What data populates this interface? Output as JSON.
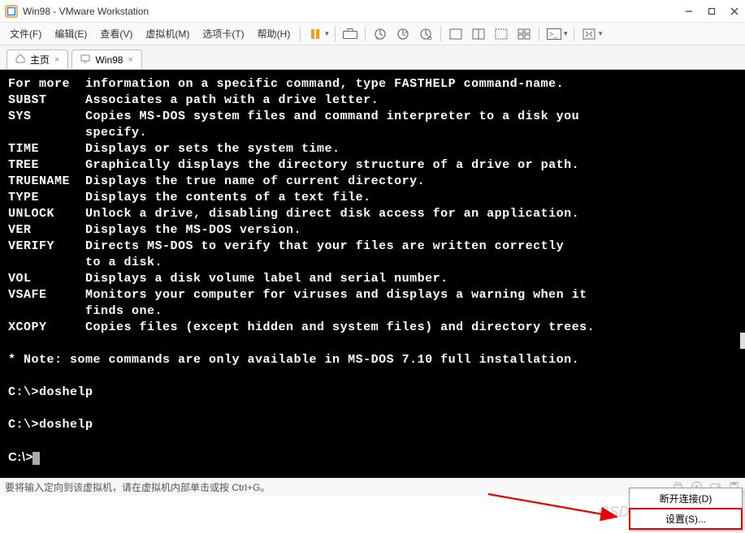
{
  "window": {
    "title": "Win98 - VMware Workstation"
  },
  "menu": {
    "items": [
      "文件(F)",
      "编辑(E)",
      "查看(V)",
      "虚拟机(M)",
      "选项卡(T)",
      "帮助(H)"
    ]
  },
  "tabs": {
    "home": "主页",
    "active": "Win98"
  },
  "console": {
    "lines": [
      "For more  information on a specific command, type FASTHELP command-name.",
      "SUBST     Associates a path with a drive letter.",
      "SYS       Copies MS-DOS system files and command interpreter to a disk you",
      "          specify.",
      "TIME      Displays or sets the system time.",
      "TREE      Graphically displays the directory structure of a drive or path.",
      "TRUENAME  Displays the true name of current directory.",
      "TYPE      Displays the contents of a text file.",
      "UNLOCK    Unlock a drive, disabling direct disk access for an application.",
      "VER       Displays the MS-DOS version.",
      "VERIFY    Directs MS-DOS to verify that your files are written correctly",
      "          to a disk.",
      "VOL       Displays a disk volume label and serial number.",
      "VSAFE     Monitors your computer for viruses and displays a warning when it",
      "          finds one.",
      "XCOPY     Copies files (except hidden and system files) and directory trees.",
      "",
      "* Note: some commands are only available in MS-DOS 7.10 full installation.",
      "",
      "C:\\>doshelp",
      "",
      "C:\\>doshelp",
      "",
      "C:\\>_"
    ]
  },
  "status": {
    "text": "要将输入定向到该虚拟机，请在虚拟机内部单击或按 Ctrl+G。"
  },
  "contextmenu": {
    "disconnect": "断开连接(D)",
    "settings": "设置(S)..."
  },
  "watermark": "CSDN @Python老吕"
}
